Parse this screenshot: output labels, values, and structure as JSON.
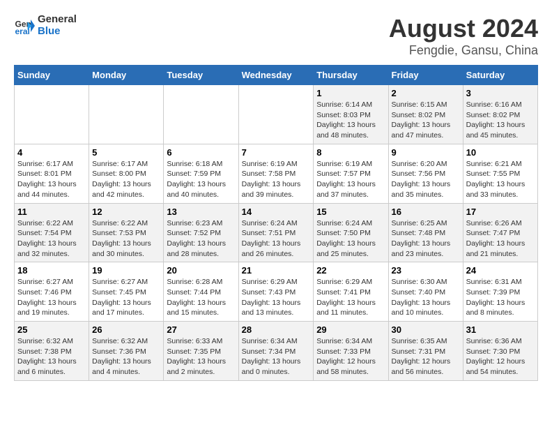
{
  "header": {
    "logo_general": "General",
    "logo_blue": "Blue",
    "title": "August 2024",
    "subtitle": "Fengdie, Gansu, China"
  },
  "weekdays": [
    "Sunday",
    "Monday",
    "Tuesday",
    "Wednesday",
    "Thursday",
    "Friday",
    "Saturday"
  ],
  "weeks": [
    [
      {
        "day": "",
        "info": ""
      },
      {
        "day": "",
        "info": ""
      },
      {
        "day": "",
        "info": ""
      },
      {
        "day": "",
        "info": ""
      },
      {
        "day": "1",
        "info": "Sunrise: 6:14 AM\nSunset: 8:03 PM\nDaylight: 13 hours\nand 48 minutes."
      },
      {
        "day": "2",
        "info": "Sunrise: 6:15 AM\nSunset: 8:02 PM\nDaylight: 13 hours\nand 47 minutes."
      },
      {
        "day": "3",
        "info": "Sunrise: 6:16 AM\nSunset: 8:02 PM\nDaylight: 13 hours\nand 45 minutes."
      }
    ],
    [
      {
        "day": "4",
        "info": "Sunrise: 6:17 AM\nSunset: 8:01 PM\nDaylight: 13 hours\nand 44 minutes."
      },
      {
        "day": "5",
        "info": "Sunrise: 6:17 AM\nSunset: 8:00 PM\nDaylight: 13 hours\nand 42 minutes."
      },
      {
        "day": "6",
        "info": "Sunrise: 6:18 AM\nSunset: 7:59 PM\nDaylight: 13 hours\nand 40 minutes."
      },
      {
        "day": "7",
        "info": "Sunrise: 6:19 AM\nSunset: 7:58 PM\nDaylight: 13 hours\nand 39 minutes."
      },
      {
        "day": "8",
        "info": "Sunrise: 6:19 AM\nSunset: 7:57 PM\nDaylight: 13 hours\nand 37 minutes."
      },
      {
        "day": "9",
        "info": "Sunrise: 6:20 AM\nSunset: 7:56 PM\nDaylight: 13 hours\nand 35 minutes."
      },
      {
        "day": "10",
        "info": "Sunrise: 6:21 AM\nSunset: 7:55 PM\nDaylight: 13 hours\nand 33 minutes."
      }
    ],
    [
      {
        "day": "11",
        "info": "Sunrise: 6:22 AM\nSunset: 7:54 PM\nDaylight: 13 hours\nand 32 minutes."
      },
      {
        "day": "12",
        "info": "Sunrise: 6:22 AM\nSunset: 7:53 PM\nDaylight: 13 hours\nand 30 minutes."
      },
      {
        "day": "13",
        "info": "Sunrise: 6:23 AM\nSunset: 7:52 PM\nDaylight: 13 hours\nand 28 minutes."
      },
      {
        "day": "14",
        "info": "Sunrise: 6:24 AM\nSunset: 7:51 PM\nDaylight: 13 hours\nand 26 minutes."
      },
      {
        "day": "15",
        "info": "Sunrise: 6:24 AM\nSunset: 7:50 PM\nDaylight: 13 hours\nand 25 minutes."
      },
      {
        "day": "16",
        "info": "Sunrise: 6:25 AM\nSunset: 7:48 PM\nDaylight: 13 hours\nand 23 minutes."
      },
      {
        "day": "17",
        "info": "Sunrise: 6:26 AM\nSunset: 7:47 PM\nDaylight: 13 hours\nand 21 minutes."
      }
    ],
    [
      {
        "day": "18",
        "info": "Sunrise: 6:27 AM\nSunset: 7:46 PM\nDaylight: 13 hours\nand 19 minutes."
      },
      {
        "day": "19",
        "info": "Sunrise: 6:27 AM\nSunset: 7:45 PM\nDaylight: 13 hours\nand 17 minutes."
      },
      {
        "day": "20",
        "info": "Sunrise: 6:28 AM\nSunset: 7:44 PM\nDaylight: 13 hours\nand 15 minutes."
      },
      {
        "day": "21",
        "info": "Sunrise: 6:29 AM\nSunset: 7:43 PM\nDaylight: 13 hours\nand 13 minutes."
      },
      {
        "day": "22",
        "info": "Sunrise: 6:29 AM\nSunset: 7:41 PM\nDaylight: 13 hours\nand 11 minutes."
      },
      {
        "day": "23",
        "info": "Sunrise: 6:30 AM\nSunset: 7:40 PM\nDaylight: 13 hours\nand 10 minutes."
      },
      {
        "day": "24",
        "info": "Sunrise: 6:31 AM\nSunset: 7:39 PM\nDaylight: 13 hours\nand 8 minutes."
      }
    ],
    [
      {
        "day": "25",
        "info": "Sunrise: 6:32 AM\nSunset: 7:38 PM\nDaylight: 13 hours\nand 6 minutes."
      },
      {
        "day": "26",
        "info": "Sunrise: 6:32 AM\nSunset: 7:36 PM\nDaylight: 13 hours\nand 4 minutes."
      },
      {
        "day": "27",
        "info": "Sunrise: 6:33 AM\nSunset: 7:35 PM\nDaylight: 13 hours\nand 2 minutes."
      },
      {
        "day": "28",
        "info": "Sunrise: 6:34 AM\nSunset: 7:34 PM\nDaylight: 13 hours\nand 0 minutes."
      },
      {
        "day": "29",
        "info": "Sunrise: 6:34 AM\nSunset: 7:33 PM\nDaylight: 12 hours\nand 58 minutes."
      },
      {
        "day": "30",
        "info": "Sunrise: 6:35 AM\nSunset: 7:31 PM\nDaylight: 12 hours\nand 56 minutes."
      },
      {
        "day": "31",
        "info": "Sunrise: 6:36 AM\nSunset: 7:30 PM\nDaylight: 12 hours\nand 54 minutes."
      }
    ]
  ]
}
